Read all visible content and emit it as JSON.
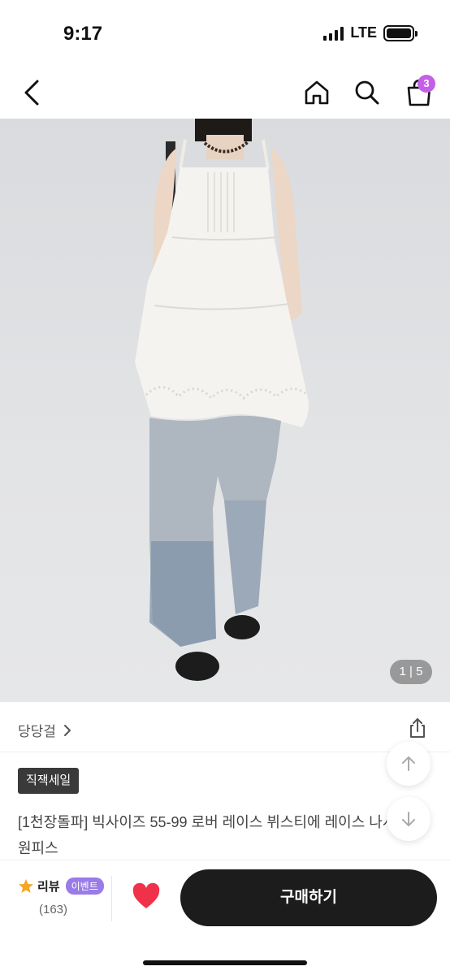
{
  "status_bar": {
    "time": "9:17",
    "network": "LTE"
  },
  "nav": {
    "cart_count": "3"
  },
  "gallery": {
    "page_current": "1",
    "page_total": "5",
    "page_separator": " | "
  },
  "seller": {
    "name": "당당걸",
    "chevron": "›"
  },
  "product": {
    "tag": "직잭세일",
    "title": "[1천장돌파] 빅사이즈 55-99 로버 레이스 뷔스티에 레이스 나시 원피스"
  },
  "bottom_bar": {
    "review_label": "리뷰",
    "event_badge": "이벤트",
    "review_count": "(163)",
    "buy_label": "구매하기"
  },
  "colors": {
    "accent_badge": "#c55fe8",
    "event_badge": "#9a7be8",
    "heart": "#f0314a",
    "buy_button": "#1c1c1c",
    "star": "#f5a623"
  },
  "icons": [
    "back-icon",
    "home-icon",
    "search-icon",
    "cart-icon",
    "share-icon",
    "arrow-up-icon",
    "arrow-down-icon",
    "star-icon",
    "heart-icon"
  ]
}
